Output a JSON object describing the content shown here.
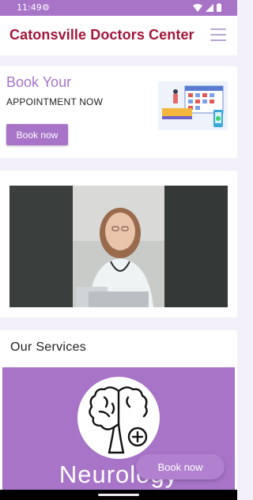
{
  "status_bar": {
    "time": "11:49"
  },
  "header": {
    "title": "Catonsville Doctors Center"
  },
  "hero": {
    "title": "Book Your",
    "subtitle": "APPOINTMENT NOW",
    "button_label": "Book now"
  },
  "services": {
    "title": "Our Services",
    "current_service": "Neurology",
    "service_icon": "brain-plus-icon"
  },
  "floating_button": {
    "label": "Book now"
  },
  "colors": {
    "accent": "#a774c7",
    "title_red": "#a3163a",
    "background": "#f3f0fa"
  }
}
